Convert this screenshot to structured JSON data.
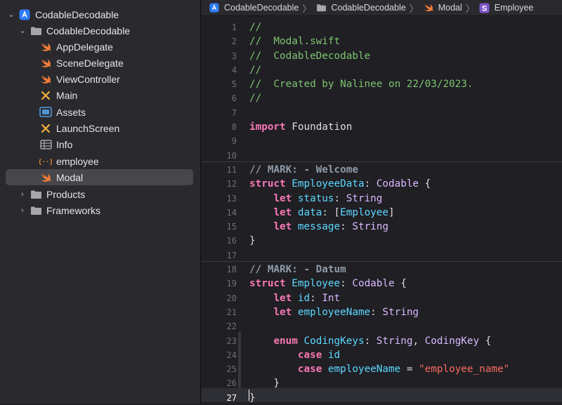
{
  "sidebar": {
    "project": "CodableDecodable",
    "group": "CodableDecodable",
    "files": [
      {
        "label": "AppDelegate",
        "icon": "swift-file-icon"
      },
      {
        "label": "SceneDelegate",
        "icon": "swift-file-icon"
      },
      {
        "label": "ViewController",
        "icon": "swift-file-icon"
      },
      {
        "label": "Main",
        "icon": "storyboard-icon"
      },
      {
        "label": "Assets",
        "icon": "asset-catalog-icon"
      },
      {
        "label": "LaunchScreen",
        "icon": "storyboard-icon"
      },
      {
        "label": "Info",
        "icon": "plist-icon"
      },
      {
        "label": "employee",
        "icon": "json-file-icon"
      },
      {
        "label": "Modal",
        "icon": "swift-file-icon"
      }
    ],
    "folders": [
      "Products",
      "Frameworks"
    ],
    "selected": "Modal"
  },
  "jumpbar": {
    "crumbs": [
      "CodableDecodable",
      "CodableDecodable",
      "Modal",
      "Employee"
    ],
    "symbol_letter": "S"
  },
  "editor": {
    "current_line": 27,
    "lines": [
      [
        [
          "com",
          "//"
        ]
      ],
      [
        [
          "com",
          "//  Modal.swift"
        ]
      ],
      [
        [
          "com",
          "//  CodableDecodable"
        ]
      ],
      [
        [
          "com",
          "//"
        ]
      ],
      [
        [
          "com",
          "//  Created by Nalinee on 22/03/2023."
        ]
      ],
      [
        [
          "com",
          "//"
        ]
      ],
      [],
      [
        [
          "kw",
          "import"
        ],
        [
          "plain",
          " Foundation"
        ]
      ],
      [],
      [],
      [
        [
          "mark",
          "// MARK: - Welcome"
        ]
      ],
      [
        [
          "kw",
          "struct"
        ],
        [
          "plain",
          " "
        ],
        [
          "decl",
          "EmployeeData"
        ],
        [
          "plain",
          ": "
        ],
        [
          "type",
          "Codable"
        ],
        [
          "plain",
          " {"
        ]
      ],
      [
        [
          "plain",
          "    "
        ],
        [
          "kw",
          "let"
        ],
        [
          "plain",
          " "
        ],
        [
          "decl",
          "status"
        ],
        [
          "plain",
          ": "
        ],
        [
          "type",
          "String"
        ]
      ],
      [
        [
          "plain",
          "    "
        ],
        [
          "kw",
          "let"
        ],
        [
          "plain",
          " "
        ],
        [
          "decl",
          "data"
        ],
        [
          "plain",
          ": ["
        ],
        [
          "decl",
          "Employee"
        ],
        [
          "plain",
          "]"
        ]
      ],
      [
        [
          "plain",
          "    "
        ],
        [
          "kw",
          "let"
        ],
        [
          "plain",
          " "
        ],
        [
          "decl",
          "message"
        ],
        [
          "plain",
          ": "
        ],
        [
          "type",
          "String"
        ]
      ],
      [
        [
          "plain",
          "}"
        ]
      ],
      [],
      [
        [
          "mark",
          "// MARK: - Datum"
        ]
      ],
      [
        [
          "kw",
          "struct"
        ],
        [
          "plain",
          " "
        ],
        [
          "decl",
          "Employee"
        ],
        [
          "plain",
          ": "
        ],
        [
          "type",
          "Codable"
        ],
        [
          "plain",
          " {"
        ]
      ],
      [
        [
          "plain",
          "    "
        ],
        [
          "kw",
          "let"
        ],
        [
          "plain",
          " "
        ],
        [
          "decl",
          "id"
        ],
        [
          "plain",
          ": "
        ],
        [
          "type",
          "Int"
        ]
      ],
      [
        [
          "plain",
          "    "
        ],
        [
          "kw",
          "let"
        ],
        [
          "plain",
          " "
        ],
        [
          "decl",
          "employeeName"
        ],
        [
          "plain",
          ": "
        ],
        [
          "type",
          "String"
        ]
      ],
      [],
      [
        [
          "plain",
          "    "
        ],
        [
          "kw",
          "enum"
        ],
        [
          "plain",
          " "
        ],
        [
          "decl",
          "CodingKeys"
        ],
        [
          "plain",
          ": "
        ],
        [
          "type",
          "String"
        ],
        [
          "plain",
          ", "
        ],
        [
          "type",
          "CodingKey"
        ],
        [
          "plain",
          " {"
        ]
      ],
      [
        [
          "plain",
          "        "
        ],
        [
          "kw",
          "case"
        ],
        [
          "plain",
          " "
        ],
        [
          "decl",
          "id"
        ]
      ],
      [
        [
          "plain",
          "        "
        ],
        [
          "kw",
          "case"
        ],
        [
          "plain",
          " "
        ],
        [
          "decl",
          "employeeName"
        ],
        [
          "plain",
          " = "
        ],
        [
          "str",
          "\"employee_name\""
        ]
      ],
      [
        [
          "plain",
          "    }"
        ]
      ],
      [
        [
          "plain",
          "}"
        ]
      ]
    ]
  },
  "colors": {
    "comment": "#7ec46f",
    "keyword": "#f878b4",
    "type": "#dabaff",
    "declaration": "#5dd8ff",
    "string": "#fc6a5d",
    "selection": "#47474b"
  }
}
